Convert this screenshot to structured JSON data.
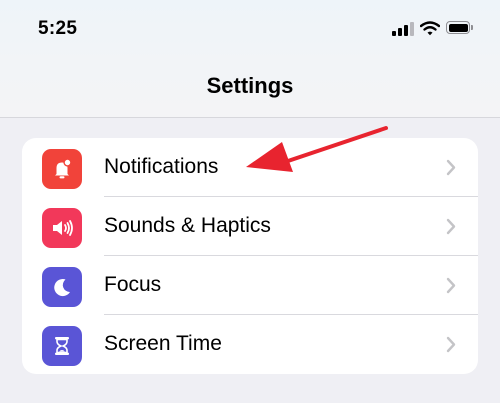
{
  "status_bar": {
    "time": "5:25",
    "icons": [
      "cellular-signal-icon",
      "wifi-icon",
      "battery-icon"
    ]
  },
  "header": {
    "title": "Settings"
  },
  "settings_rows": [
    {
      "label": "Notifications",
      "icon": "bell-icon",
      "icon_color": "#f1433a"
    },
    {
      "label": "Sounds & Haptics",
      "icon": "speaker-icon",
      "icon_color": "#f2385a"
    },
    {
      "label": "Focus",
      "icon": "moon-icon",
      "icon_color": "#5a55d6"
    },
    {
      "label": "Screen Time",
      "icon": "hourglass-icon",
      "icon_color": "#5a55d6"
    }
  ],
  "annotation": {
    "icon": "red-arrow-icon",
    "color": "#e8242f"
  },
  "colors": {
    "background": "#efeff4",
    "chevron": "#c4c4c7"
  }
}
